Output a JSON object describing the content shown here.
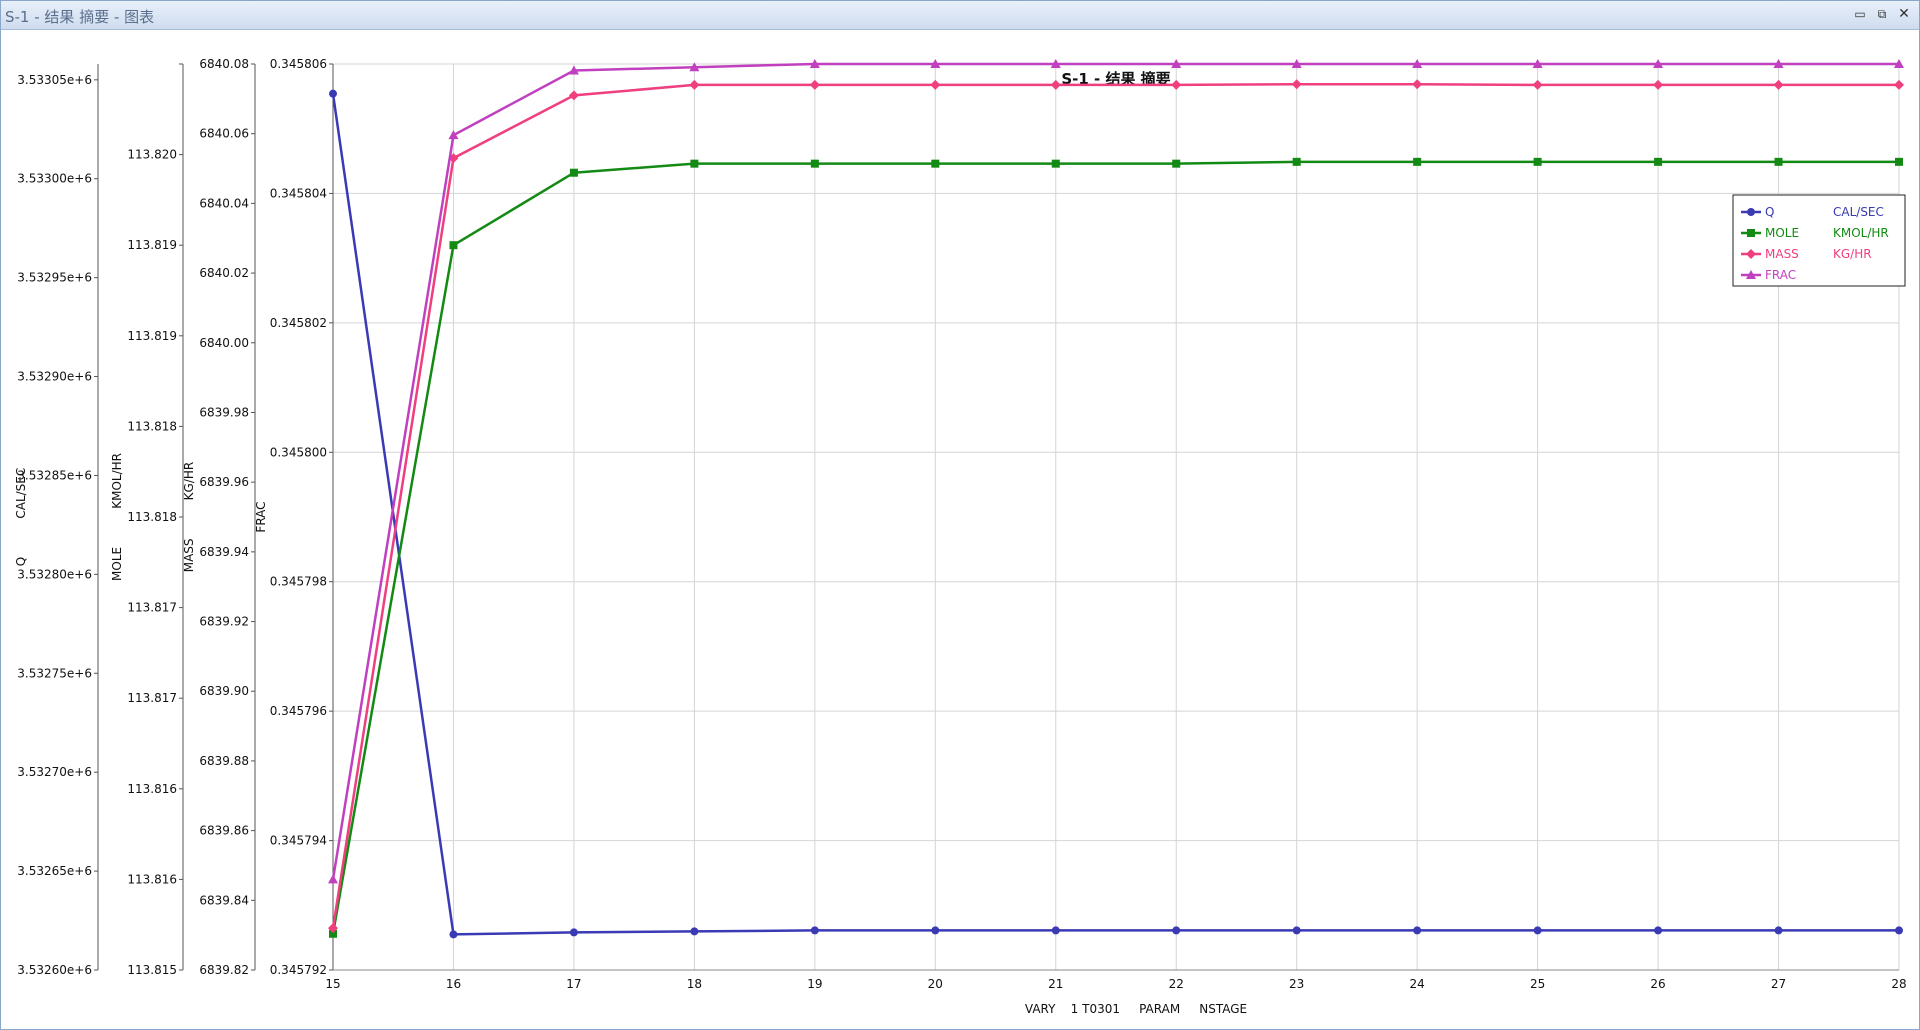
{
  "window": {
    "title": "S-1 - 结果 摘要 - 图表",
    "minimize_label": "▭",
    "restore_label": "⧉",
    "close_label": "✕"
  },
  "chart_data": {
    "type": "line",
    "title": "S-1 - 结果 摘要",
    "xlabel": "VARY    1 T0301     PARAM     NSTAGE",
    "x": [
      15,
      16,
      17,
      18,
      19,
      20,
      21,
      22,
      23,
      24,
      25,
      26,
      27,
      28
    ],
    "xlim": [
      15,
      28
    ],
    "grid": true,
    "legend_position": "top-right",
    "axes": [
      {
        "id": "q",
        "label": "Q          CAL/SEC",
        "ylim": [
          3532600,
          3533058
        ],
        "ticks": [
          3532600,
          3532650,
          3532700,
          3532750,
          3532800,
          3532850,
          3532900,
          3532950,
          3533000,
          3533050
        ],
        "tick_labels": [
          "3.53260e+6",
          "3.53265e+6",
          "3.53270e+6",
          "3.53275e+6",
          "3.53280e+6",
          "3.53285e+6",
          "3.53290e+6",
          "3.53295e+6",
          "3.53300e+6",
          "3.53305e+6"
        ]
      },
      {
        "id": "mole",
        "label": "MOLE          KMOL/HR",
        "ylim": [
          113.815,
          113.82
        ],
        "ticks": [
          113.815,
          113.8155,
          113.816,
          113.8165,
          113.817,
          113.8175,
          113.818,
          113.8185,
          113.819,
          113.8195,
          113.82
        ],
        "tick_labels": [
          "113.815",
          "113.816",
          "113.816",
          "113.817",
          "113.817",
          "113.818",
          "113.818",
          "113.819",
          "113.819",
          "113.820"
        ]
      },
      {
        "id": "mass",
        "label": "MASS          KG/HR",
        "ylim": [
          6839.82,
          6840.08
        ],
        "ticks": [
          6839.82,
          6839.84,
          6839.86,
          6839.88,
          6839.9,
          6839.92,
          6839.94,
          6839.96,
          6839.98,
          6840.0,
          6840.02,
          6840.04,
          6840.06,
          6840.08
        ],
        "tick_labels": [
          "6839.82",
          "6839.84",
          "6839.86",
          "6839.88",
          "6839.90",
          "6839.92",
          "6839.94",
          "6839.96",
          "6839.98",
          "6840.00",
          "6840.02",
          "6840.04",
          "6840.06",
          "6840.08"
        ]
      },
      {
        "id": "frac",
        "label": "FRAC",
        "ylim": [
          0.345792,
          0.345806
        ],
        "ticks": [
          0.345792,
          0.345794,
          0.345796,
          0.345798,
          0.3458,
          0.345802,
          0.345804,
          0.345806
        ],
        "tick_labels": [
          "0.345792",
          "0.345794",
          "0.345796",
          "0.345798",
          "0.345800",
          "0.345802",
          "0.345804",
          "0.345806"
        ]
      }
    ],
    "series": [
      {
        "name": "Q",
        "unit": "CAL/SEC",
        "axis": "q",
        "color": "#3a3ab4",
        "marker": "circle",
        "values": [
          3533043,
          3532618,
          3532619,
          3532619.5,
          3532620,
          3532620,
          3532620,
          3532620,
          3532620,
          3532620,
          3532620,
          3532620,
          3532620,
          3532620
        ]
      },
      {
        "name": "MOLE",
        "unit": "KMOL/HR",
        "axis": "mole",
        "color": "#138a13",
        "marker": "square",
        "values": [
          113.8152,
          113.819,
          113.8194,
          113.81945,
          113.81945,
          113.81945,
          113.81945,
          113.81945,
          113.81946,
          113.81946,
          113.81946,
          113.81946,
          113.81946,
          113.81946
        ]
      },
      {
        "name": "MASS",
        "unit": "KG/HR",
        "axis": "mass",
        "color": "#ef3f7f",
        "marker": "diamond",
        "values": [
          6839.832,
          6840.053,
          6840.071,
          6840.074,
          6840.074,
          6840.074,
          6840.074,
          6840.074,
          6840.0742,
          6840.0742,
          6840.074,
          6840.074,
          6840.074,
          6840.074
        ]
      },
      {
        "name": "FRAC",
        "unit": "",
        "axis": "frac",
        "color": "#c040c0",
        "marker": "triangle",
        "values": [
          0.3457934,
          0.3458049,
          0.3458059,
          0.34580595,
          0.345806,
          0.345806,
          0.345806,
          0.345806,
          0.345806,
          0.345806,
          0.345806,
          0.345806,
          0.345806,
          0.345806
        ]
      }
    ]
  }
}
